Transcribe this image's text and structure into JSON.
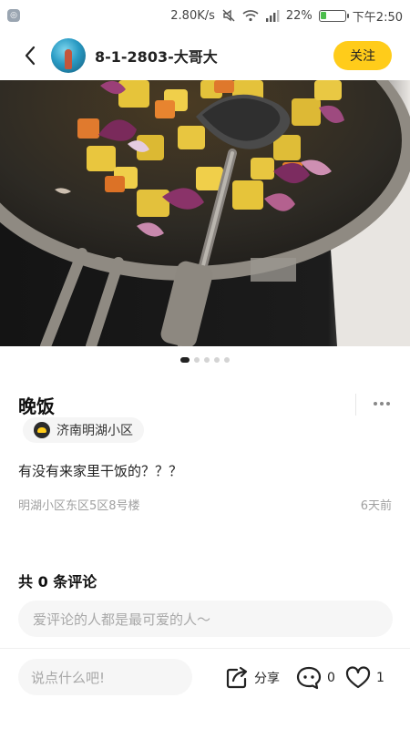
{
  "status_bar": {
    "speed": "2.80K/s",
    "battery_percent": "22%",
    "battery_level": 0.22,
    "time": "下午2:50"
  },
  "header": {
    "back_icon": "chevron-left-icon",
    "username": "8-1-2803-大哥大",
    "follow_label": "关注"
  },
  "gallery": {
    "image_count": 5,
    "active_index": 0
  },
  "post": {
    "title": "晚饭",
    "location_tag": "济南明湖小区",
    "body": "有没有来家里干饭的？？？",
    "address": "明湖小区东区5区8号楼",
    "time_ago": "6天前"
  },
  "comments": {
    "title": "共 0 条评论",
    "placeholder": "爱评论的人都是最可爱的人～"
  },
  "bottom_bar": {
    "input_placeholder": "说点什么吧!",
    "share_label": "分享",
    "comment_count": "0",
    "like_count": "1"
  },
  "colors": {
    "accent": "#ffcc1a",
    "battery": "#4cbd4c",
    "muted_text": "#a0a0a0"
  }
}
